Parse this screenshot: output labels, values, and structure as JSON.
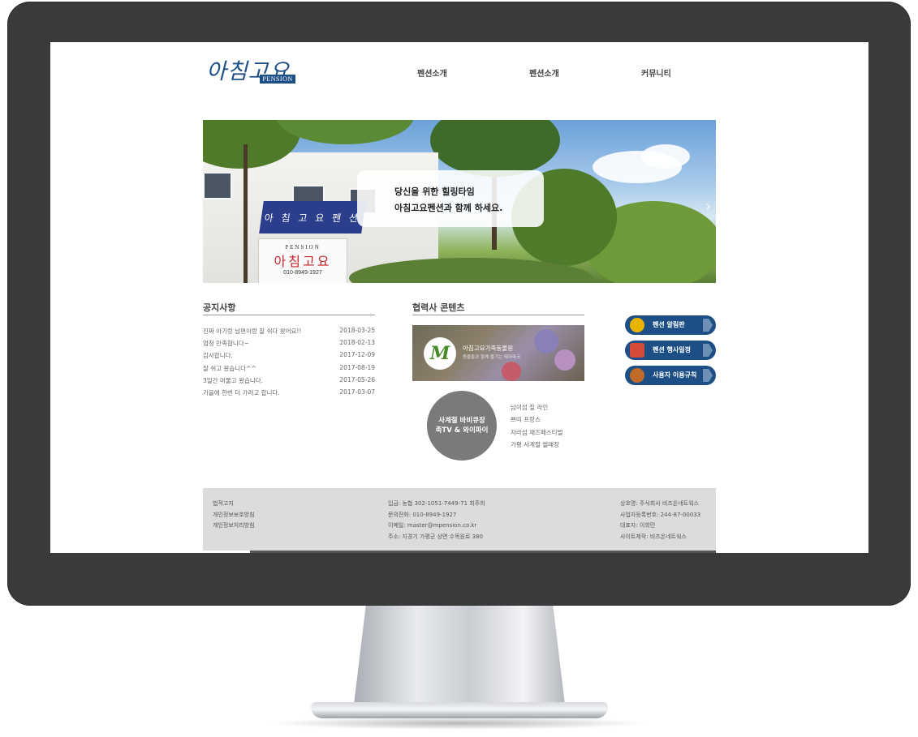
{
  "header": {
    "logo_text": "아침고요",
    "logo_badge": "PENSION",
    "nav": [
      "펜션소개",
      "펜션소개",
      "커뮤니티"
    ]
  },
  "hero": {
    "caption_line1": "당신을 위한 힐링타임",
    "caption_line2": "아침고요펜션과 함께 하세요.",
    "awning_text": "아 침 고 요 펜 션",
    "sign_top": "PENSION",
    "sign_main": "아침고요",
    "sign_phone": "010-8949-1927",
    "next_icon": "chevron-right-icon"
  },
  "notices": {
    "title": "공지사항",
    "items": [
      {
        "title": "진짜 아기랑 남편이랑 잘 쉬다 왔어요!!",
        "date": "2018-03-25"
      },
      {
        "title": "엄청 만족합니다~",
        "date": "2018-02-13"
      },
      {
        "title": "감사합니다.",
        "date": "2017-12-09"
      },
      {
        "title": "잘 쉬고 왔습니다^^",
        "date": "2017-08-19"
      },
      {
        "title": "3일간 머물고 왔습니다.",
        "date": "2017-05-26"
      },
      {
        "title": "가을에 한번 더 가려고 합니다.",
        "date": "2017-03-07"
      }
    ]
  },
  "partner": {
    "title": "협력사 콘텐츠",
    "banner_name": "아침고요가족동물원",
    "banner_sub": "동물들과 함께 즐기는 테마파크",
    "bbq_line1": "사계절 바비큐장",
    "bbq_line2": "족TV & 와이파이",
    "bbq_items": [
      "남이섬 짚 라인",
      "쁘띠 프랑스",
      "자라섬 재즈페스티벌",
      "가평 사계절 썰매장"
    ]
  },
  "quick_buttons": [
    {
      "label": "펜션 알림판",
      "icon": "bell-icon",
      "icon_color": "#e8b400"
    },
    {
      "label": "펜션 행사일정",
      "icon": "calendar-icon",
      "icon_color": "#d64a3a"
    },
    {
      "label": "사용자 이용규칙",
      "icon": "bbq-icon",
      "icon_color": "#c06a2a"
    }
  ],
  "footer": {
    "links": [
      "법적고지",
      "개인정보보호방침",
      "개인정보처리방침"
    ],
    "bank": "입금: 농협 302-1051-7449-71 최주희",
    "phone": "문의전화: 010-8949-1927",
    "email": "이메일: master@mpension.co.kr",
    "address": "주소: 지경기 가평군 상면 수목원로 380",
    "company": "상호명: 주식회사 비즈온네트웍스",
    "biz_no": "사업자등록번호: 244-87-00033",
    "ceo": "대표자: 이희민",
    "maker": "사이트제작: 비즈온네트웍스"
  },
  "colors": {
    "brand": "#1d4f86",
    "bezel": "#3a3a3a",
    "footer_bg": "#dcdcdc"
  }
}
